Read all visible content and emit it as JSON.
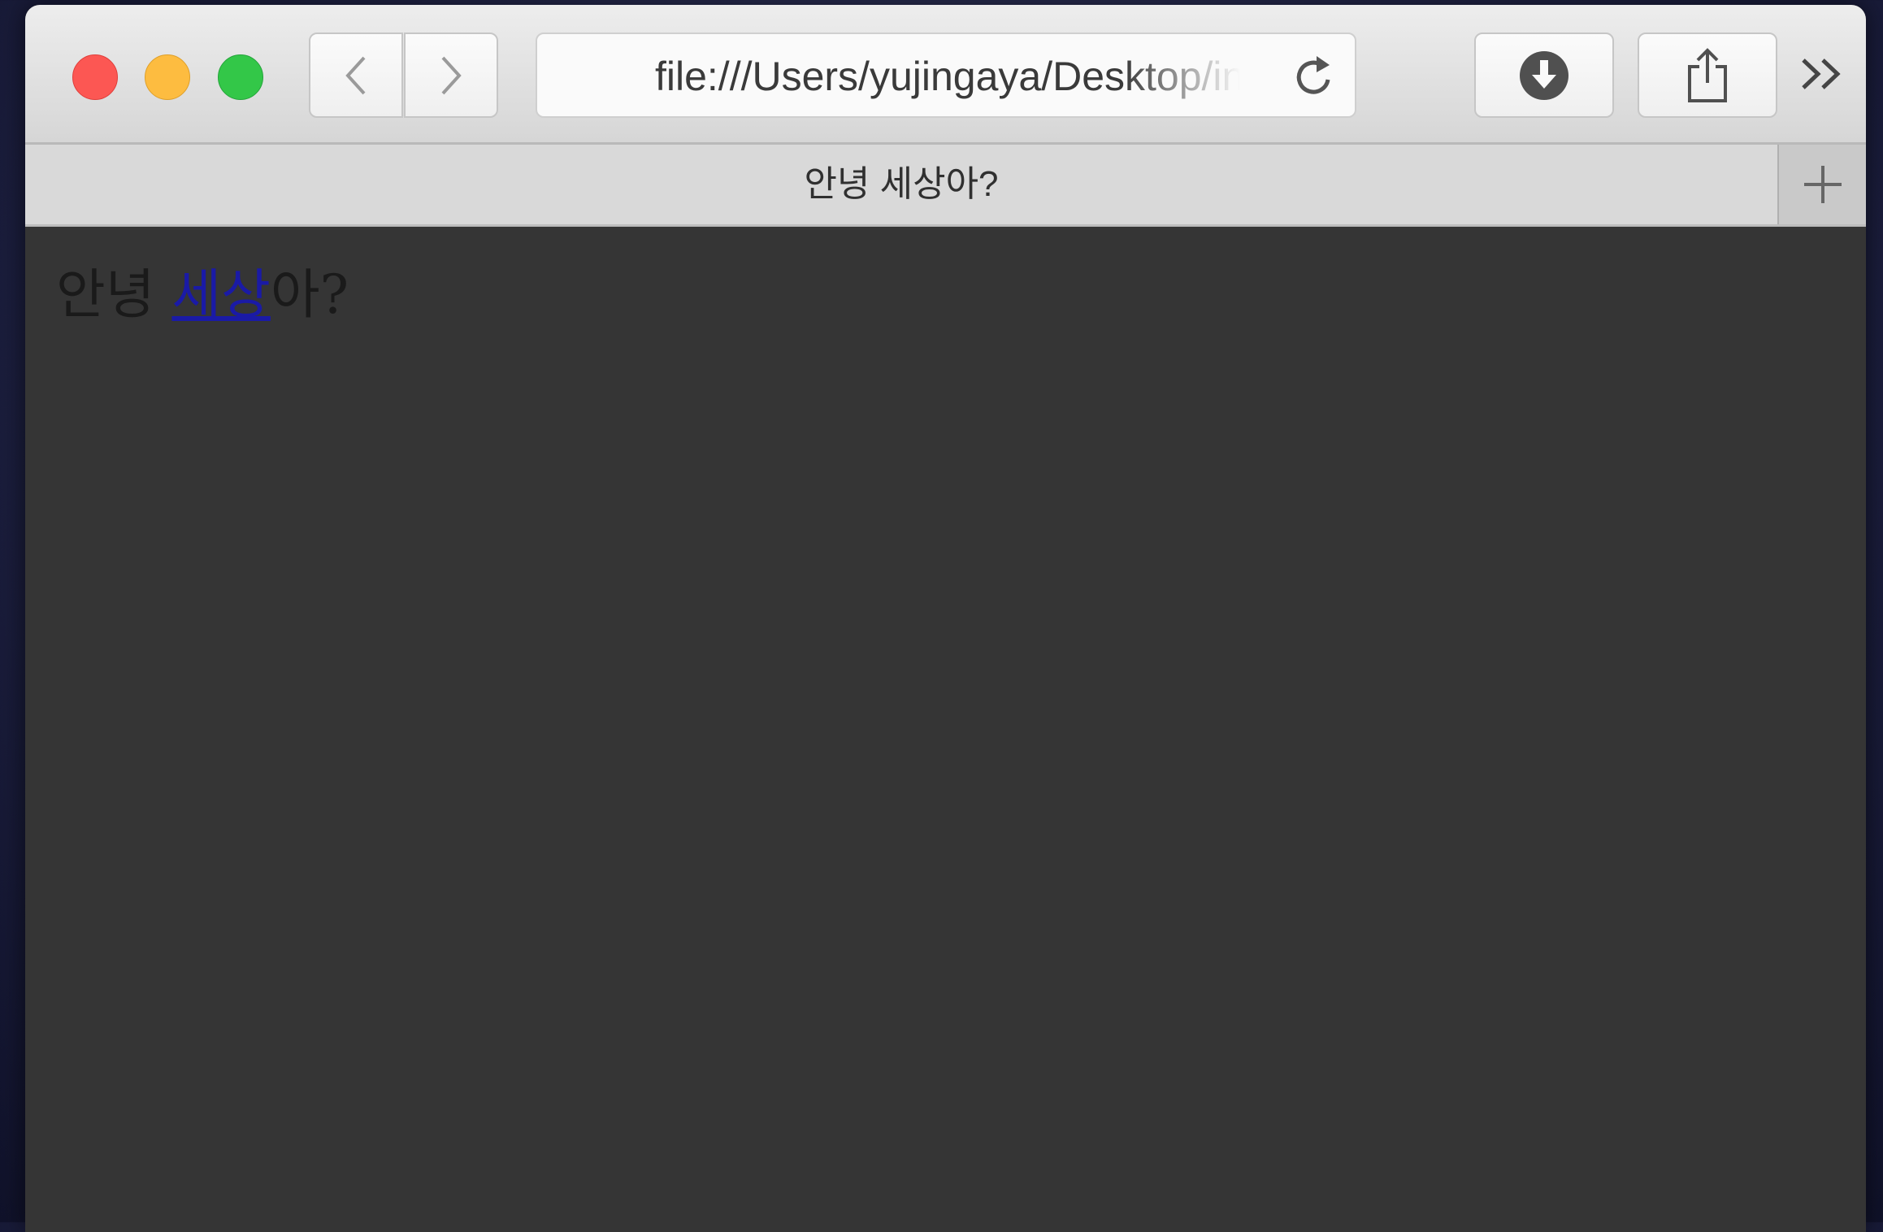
{
  "browser": {
    "url": "file:///Users/yujingaya/Desktop/index.html",
    "tab_title": "안녕 세상아?"
  },
  "toolbar_icons": {
    "back": "chevron-left-icon",
    "forward": "chevron-right-icon",
    "reload": "reload-icon",
    "downloads": "download-icon",
    "share": "share-icon",
    "overflow": "double-chevron-right-icon",
    "new_tab": "plus-icon"
  },
  "page": {
    "heading_before": "안녕 ",
    "heading_link": "세상",
    "heading_after": "아?"
  },
  "colors": {
    "page_background": "#353535",
    "link": "#1a1aa6",
    "close": "#fc5753",
    "minimize": "#fdbc40",
    "maximize": "#33c748"
  }
}
